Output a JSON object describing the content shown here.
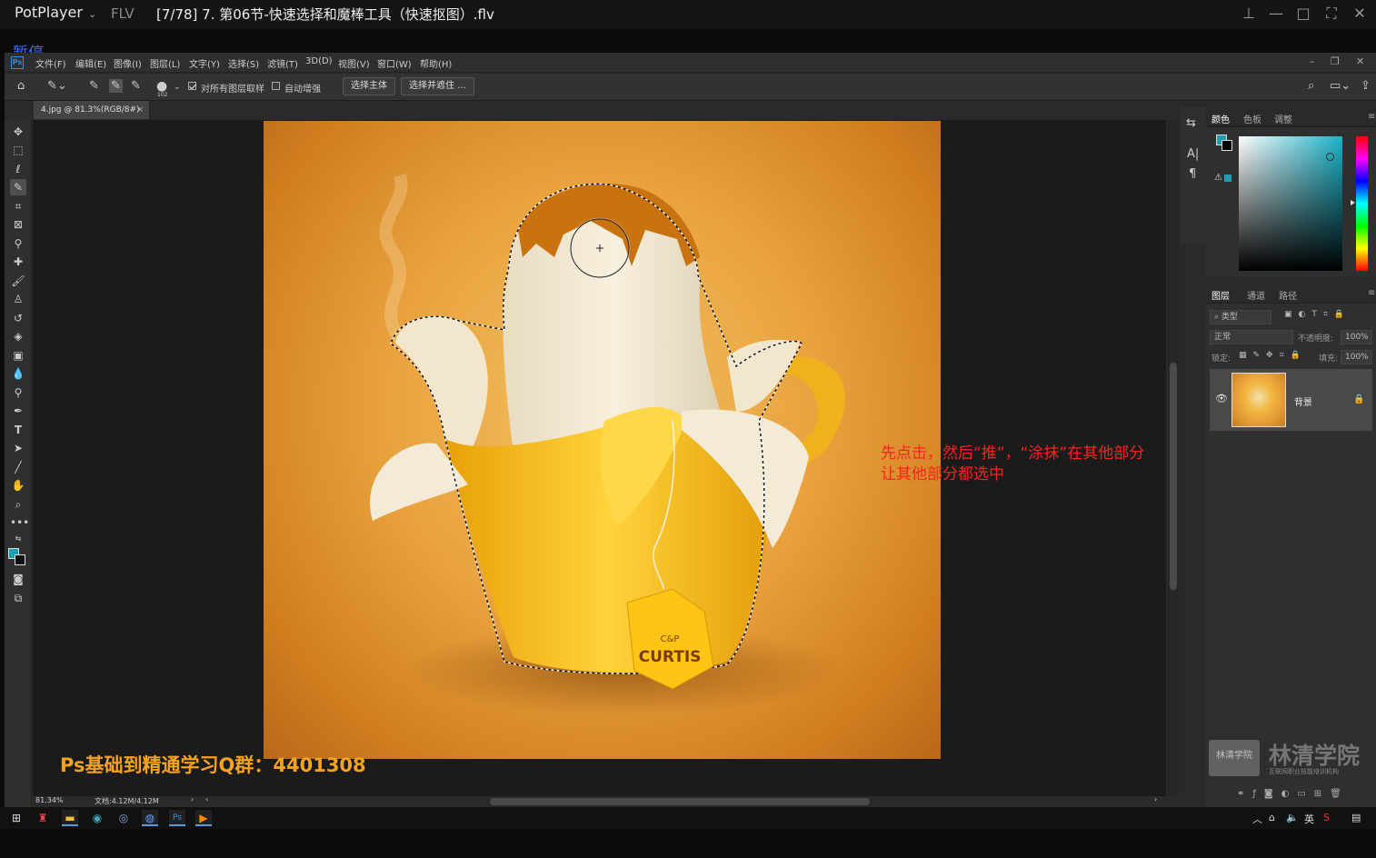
{
  "player": {
    "name": "PotPlayer",
    "format": "FLV",
    "title": "[7/78] 7. 第06节-快速选择和魔棒工具（快速抠图）.flv",
    "pause_label": "暂停"
  },
  "ps": {
    "logo": "Ps",
    "menu": [
      "文件(F)",
      "编辑(E)",
      "图像(I)",
      "图层(L)",
      "文字(Y)",
      "选择(S)",
      "滤镜(T)",
      "3D(D)",
      "视图(V)",
      "窗口(W)",
      "帮助(H)"
    ],
    "options": {
      "brush_size": "102",
      "sample_all_layers": "对所有图层取样",
      "auto_enhance": "自动增强",
      "select_subject": "选择主体",
      "select_and_mask": "选择并遮住 ..."
    },
    "doc_tab": "4.jpg @ 81.3%(RGB/8#)",
    "status": {
      "zoom": "81.34%",
      "doc": "文档:4.12M/4.12M"
    },
    "tea_tag": "CURTIS",
    "tea_tag_small": "C&P"
  },
  "panels": {
    "color_tabs": [
      "颜色",
      "色板",
      "调整"
    ],
    "layers_tabs": [
      "图层",
      "通道",
      "路径"
    ],
    "kind_placeholder": "类型",
    "blend_mode": "正常",
    "opacity_label": "不透明度:",
    "opacity_value": "100%",
    "lock_label": "锁定:",
    "fill_label": "填充:",
    "fill_value": "100%",
    "layer_name": "背景"
  },
  "overlay": {
    "annotation_line1": "先点击，然后“推”，“涂抹”在其他部分",
    "annotation_line2": "让其他部分都选中",
    "qq_group": "Ps基础到精通学习Q群：4401308",
    "watermark": "林清学院",
    "watermark_badge": "林清学院",
    "watermark_sub": "互联网职业技能培训机构"
  },
  "taskbar": {
    "ime": "英"
  },
  "colors": {
    "foreground": "#1aa0b0",
    "annotation": "#ff2020",
    "qq_text": "#f4a31e"
  }
}
